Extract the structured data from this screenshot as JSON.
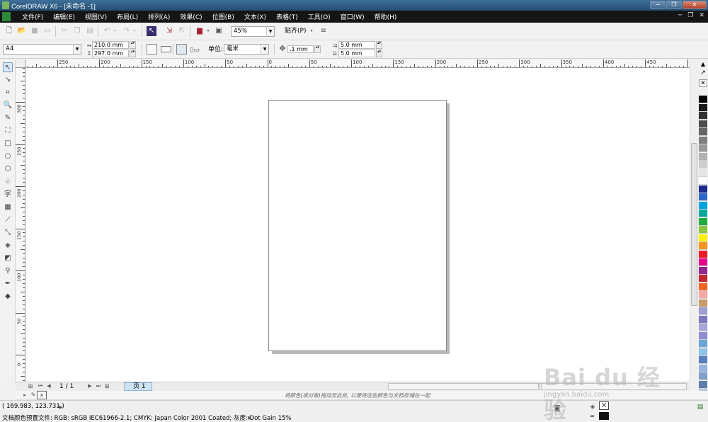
{
  "window": {
    "title": "CorelDRAW X6 - [未命名 -1]"
  },
  "menu": [
    "文件(F)",
    "编辑(E)",
    "视图(V)",
    "布局(L)",
    "排列(A)",
    "效果(C)",
    "位图(B)",
    "文本(X)",
    "表格(T)",
    "工具(O)",
    "窗口(W)",
    "帮助(H)"
  ],
  "window_controls": {
    "minimize": "─",
    "restore": "❐",
    "close": "✕",
    "menu_min": "─",
    "menu_restore": "❐",
    "menu_close": "✕"
  },
  "standard_toolbar": {
    "zoom_level": "45%",
    "snap_label": "贴齐(P)"
  },
  "property_bar": {
    "page_preset": "A4",
    "page_width": "210.0 mm",
    "page_height": "297.0 mm",
    "units_label": "单位:",
    "units_value": "毫米",
    "nudge": ".1 mm",
    "dup_x": "5.0 mm",
    "dup_y": "5.0 mm"
  },
  "rulers": {
    "horizontal_labels": [
      "250",
      "200",
      "150",
      "100",
      "50",
      "0",
      "50",
      "100",
      "150",
      "200",
      "250",
      "300",
      "350",
      "400",
      "450"
    ],
    "vertical_labels": [
      "300",
      "250",
      "200",
      "150",
      "100",
      "50",
      "0"
    ]
  },
  "page_nav": {
    "page_count": "1 / 1",
    "page_tab": "页 1"
  },
  "hint": "将颜色(或对象)拖动至此处, 以便将这些颜色与文档存储在一起",
  "status": {
    "coordinates": "( 169.983, 123.731 )",
    "color_profile": "文档颜色预置文件: RGB: sRGB IEC61966-2.1; CMYK: Japan Color 2001 Coated; 灰度: Dot Gain 15%"
  },
  "watermark": {
    "main": "Bai du 经验",
    "sub": "jingyan.baidu.com"
  },
  "palette_colors": [
    "#000000",
    "#1a1a1a",
    "#333333",
    "#4d4d4d",
    "#666666",
    "#808080",
    "#999999",
    "#b3b3b3",
    "#cccccc",
    "#e6e6e6",
    "#ffffff",
    "#1d2b8f",
    "#2f66c9",
    "#00a2e0",
    "#00a79d",
    "#1faa3c",
    "#8cc63f",
    "#fff200",
    "#f7941d",
    "#ed1c24",
    "#ec008c",
    "#92278f",
    "#c1272d",
    "#f26522",
    "#f9a8a8",
    "#c69c6d",
    "#9e9ecf",
    "#7b79c0",
    "#a6a6d8",
    "#8d8dd0",
    "#6aa6d8",
    "#8fc3e8",
    "#5b7fbf",
    "#9ab3dd",
    "#7fa0cc",
    "#5d7eaa",
    "#b9c7de",
    "#d7e2ef"
  ]
}
